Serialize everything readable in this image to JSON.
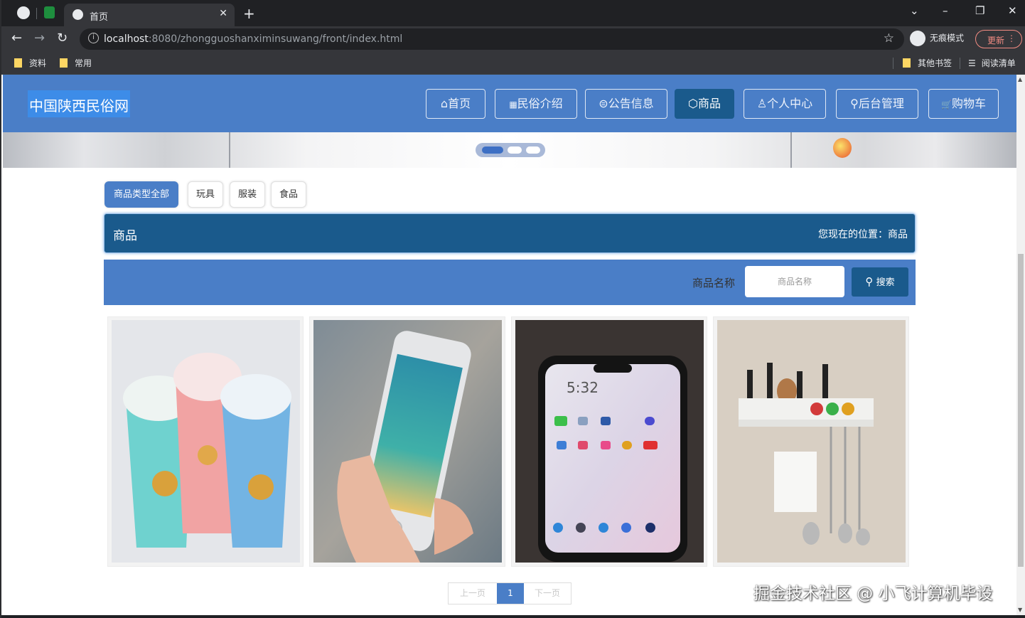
{
  "browser": {
    "tab_title": "首页",
    "url_host": "localhost",
    "url_path": ":8080/zhongguoshanximinsuwang/front/index.html",
    "incognito_label": "无痕模式",
    "update_label": "更新",
    "bookmarks": [
      "资料",
      "常用"
    ],
    "other_bookmarks": "其他书签",
    "reading_list": "阅读清单"
  },
  "site": {
    "logo": "中国陕西民俗网",
    "nav": [
      {
        "icon": "⌂",
        "label": "首页"
      },
      {
        "icon": "▦",
        "label": "民俗介绍"
      },
      {
        "icon": "⊜",
        "label": "公告信息"
      },
      {
        "icon": "⬡",
        "label": "商品"
      },
      {
        "icon": "♙",
        "label": "个人中心"
      },
      {
        "icon": "⚲",
        "label": "后台管理"
      },
      {
        "icon": "🛒",
        "label": "购物车"
      }
    ],
    "active_nav": "商品"
  },
  "categories": [
    "商品类型全部",
    "玩具",
    "服装",
    "食品"
  ],
  "section": {
    "title": "商品",
    "location": "您现在的位置：商品"
  },
  "search": {
    "label": "商品名称",
    "placeholder": "商品名称",
    "button": "搜索"
  },
  "products": [
    {
      "image": "kids-cups-photo"
    },
    {
      "image": "smartphone-in-hand-photo"
    },
    {
      "image": "smartphone-homescreen-photo"
    },
    {
      "image": "kitchen-utensil-rack-photo"
    }
  ],
  "pagination": {
    "prev": "上一页",
    "current": "1",
    "next": "下一页"
  },
  "watermark": "掘金技术社区 @ 小飞计算机毕设",
  "colors": {
    "header": "#4a7ec7",
    "accent_dark": "#1a5a8c"
  }
}
